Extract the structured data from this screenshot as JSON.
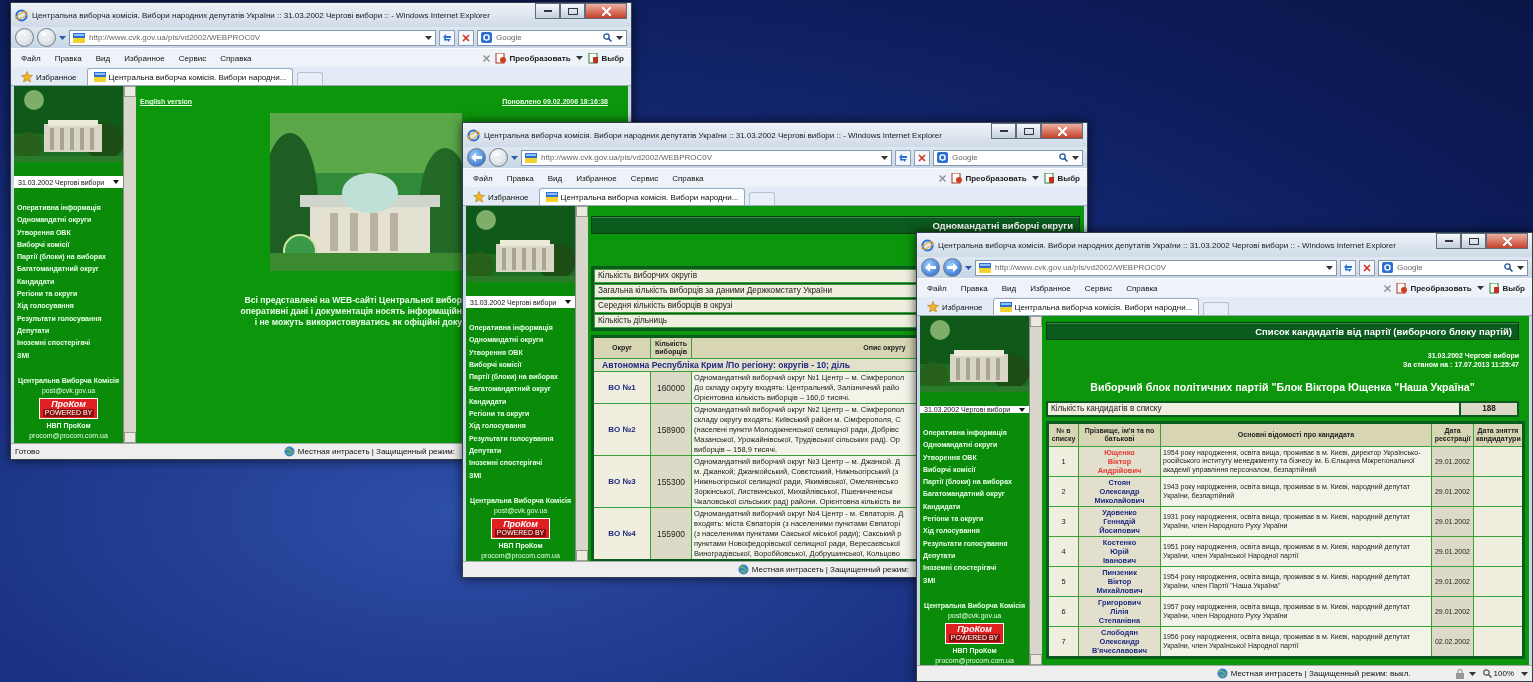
{
  "windows": [
    {
      "title": "Центральна виборча комісія. Вибори народних депутатів України :: 31.03.2002 Чергові вибори :: - Windows Internet Explorer",
      "back_enabled": false,
      "forward_enabled": false,
      "url": "http://www.cvk.gov.ua/pls/vd2002/WEBPROC0V",
      "search_placeholder": "Google",
      "menu": [
        "Файл",
        "Правка",
        "Вид",
        "Избранное",
        "Сервис",
        "Справка"
      ],
      "convert_label": "Преобразовать",
      "toolbar_cut": "Выбр",
      "favorites": "Избранное",
      "tab_title": "Центральна виборча комісія. Вибори народни...",
      "status_left": "Готово",
      "status_zone": "Местная интрасеть | Защищенный режим:",
      "sidebar": {
        "election": "31.03.2002 Чергові вибори",
        "nav": [
          "Оперативна інформація",
          "Одномандатні округи",
          "Утворення ОВК",
          "Виборчі комісії",
          "Партії (блоки) на виборах",
          "Багатомандатний округ",
          "Кандидати",
          "Регіони та округи",
          "Хід голосування",
          "Результати голосування",
          "Депутати",
          "Іноземні спостерігачі",
          "ЗМІ"
        ],
        "org": "Центральна Виборча Комісія",
        "org_email": "post@cvk.gov.ua",
        "logo_word": "ПроКом",
        "logo_tag": "POWERED BY",
        "company": "НВП ПроКом",
        "company_email": "procom@procom.com.ua"
      },
      "page": {
        "kind": "home",
        "english_link": "English version",
        "updated": "Поновлено 09.02.2006 18:16:38",
        "notice_lines": [
          "Всі представлені на WEB-сайті Центральної вибор",
          "оперативні дані і документація носять інформаційн",
          "і не можуть використовуватись як офіційні доку"
        ]
      }
    },
    {
      "title": "Центральна виборча комісія. Вибори народних депутатів України :: 31.03.2002 Чергові вибори :: - Windows Internet Explorer",
      "back_enabled": true,
      "forward_enabled": false,
      "url": "http://www.cvk.gov.ua/pls/vd2002/WEBPROC0V",
      "search_placeholder": "Google",
      "menu": [
        "Файл",
        "Правка",
        "Вид",
        "Избранное",
        "Сервис",
        "Справка"
      ],
      "convert_label": "Преобразовать",
      "toolbar_cut": "Выбр",
      "favorites": "Избранное",
      "tab_title": "Центральна виборча комісія. Вибори народни...",
      "status_zone": "Местная интрасеть | Защищенный режим:",
      "sidebar": {
        "election": "31.03.2002 Чергові вибори",
        "nav": [
          "Оперативна інформація",
          "Одномандатні округи",
          "Утворення ОВК",
          "Виборчі комісії",
          "Партії (блоки) на виборах",
          "Багатомандатний округ",
          "Кандидати",
          "Регіони та округи",
          "Хід голосування",
          "Результати голосування",
          "Депутати",
          "Іноземні спостерігачі",
          "ЗМІ"
        ],
        "org": "Центральна Виборча Комісія",
        "org_email": "post@cvk.gov.ua",
        "logo_word": "ПроКом",
        "logo_tag": "POWERED BY",
        "company": "НВП ПроКом",
        "company_email": "procom@procom.com.ua"
      },
      "page": {
        "kind": "districts",
        "heading": "Одномандатні виборчі округи",
        "summary": [
          "Кількість виборчих округів",
          "Загальна кількість виборців за даними Держкомстату України",
          "Середня кількість виборців в окрузі",
          "Кількість дільниць"
        ],
        "columns": [
          "Округ",
          "Кількість виборців",
          "Опис округу"
        ],
        "region": "Автономна Республіка Крим /По регіону: округів - 10; діль",
        "rows": [
          {
            "district": "ВО №1",
            "voters": "160000",
            "lines": [
              "Одномандатний виборчий округ №1 Центр – м. Сімферопол",
              "До складу округу входять: Центральний, Залізничний райо",
              "Орієнтовна кількість виборців – 160,0 тисячі."
            ]
          },
          {
            "district": "ВО №2",
            "voters": "158900",
            "lines": [
              "Одномандатний виборчий округ №2 Центр – м. Сімферопол",
              "складу округу входять: Київський район м. Сімферополя, С",
              "(населені пункти Молодіжненської селищної ради, Добрівс",
              "Мазанської, Урожайнівської, Трудівської сільських рад). Ор",
              "виборців – 158,9 тисячі."
            ]
          },
          {
            "district": "ВО №3",
            "voters": "155300",
            "lines": [
              "Одномандатний виборчий округ №3 Центр – м. Джанкой. Д",
              "м. Джанкой; Джанкойський, Совєтський, Нижньогірський (з",
              "Нижньогірської селищної ради, Якимівської, Омелянівсько",
              "Зоркінської, Листвинської, Михайлівської, Пшеничненськ",
              "Чкаловської сільських рад) райони. Орієнтовна кількість ви"
            ]
          },
          {
            "district": "ВО №4",
            "voters": "155900",
            "lines": [
              "Одномандатний виборчий округ №4 Центр - м. Євпаторія. Д",
              "входять: міста Євпаторія (з населеними пунктами Євпаторі",
              "(з населеними пунктами Сакської міської ради); Сакський р",
              "пунктами Новофедорівської селищної ради, Вересаєвської",
              "Виноградівської, Воробйовської, Добрушинської, Кольцово"
            ]
          }
        ]
      }
    },
    {
      "title": "Центральна виборча комісія. Вибори народних депутатів України :: 31.03.2002 Чергові вибори :: - Windows Internet Explorer",
      "back_enabled": true,
      "forward_enabled": true,
      "url": "http://www.cvk.gov.ua/pls/vd2002/WEBPROC0V",
      "search_placeholder": "Google",
      "menu": [
        "Файл",
        "Правка",
        "Вид",
        "Избранное",
        "Сервис",
        "Справка"
      ],
      "convert_label": "Преобразовать",
      "toolbar_cut": "Выбр",
      "favorites": "Избранное",
      "tab_title": "Центральна виборча комісія. Вибори народни...",
      "status_zone": "Местная интрасеть | Защищенный режим: выкл.",
      "zoom": "100%",
      "sidebar": {
        "election": "31.03.2002 Чергові вибори",
        "nav": [
          "Оперативна інформація",
          "Одномандатні округи",
          "Утворення ОВК",
          "Виборчі комісії",
          "Партії (блоки) на виборах",
          "Багатомандатний округ",
          "Кандидати",
          "Регіони та округи",
          "Хід голосування",
          "Результати голосування",
          "Депутати",
          "Іноземні спостерігачі",
          "ЗМІ"
        ],
        "org": "Центральна Виборча Комісія",
        "org_email": "post@cvk.gov.ua",
        "logo_word": "ПроКом",
        "logo_tag": "POWERED BY",
        "company": "НВП ПроКом",
        "company_email": "procom@procom.com.ua"
      },
      "page": {
        "kind": "candidates",
        "heading": "Список кандидатів від партії (виборчого блоку партій)",
        "election": "31.03.2002 Чергові вибори",
        "as_of": "За станом на : 17.07.2013 11:25:47",
        "party": "Виборчий блок політичних партій \"Блок Віктора Ющенка \"Наша Україна\"",
        "count_label": "Кількість кандидатів в списку",
        "count": "188",
        "columns": [
          "№ в списку",
          "Прізвище, ім'я та по батькові",
          "Основні відомості про кандидата",
          "Дата реєстрації",
          "Дата зняття кандидатури"
        ],
        "rows": [
          {
            "number": "1",
            "name": "Ющенко Віктор Андрійович",
            "color": "#e53935",
            "info": "1954 року народження, освіта вища, проживає в м. Києві, директор Українсько-російського інституту менеджменту та бізнесу ім. Б.Єльцина Міжрегіональної академії управління персоналом, безпартійний",
            "registered": "29.01.2002"
          },
          {
            "number": "2",
            "name": "Стоян Олександр Миколайович",
            "color": "#1f2a80",
            "info": "1943 року народження, освіта вища, проживає в м. Києві, народний депутат України, безпартійний",
            "registered": "29.01.2002"
          },
          {
            "number": "3",
            "name": "Удовенко Геннадій Йосипович",
            "color": "#1f2a80",
            "info": "1931 року народження, освіта вища, проживає в м. Києві, народний депутат України, член Народного Руху України",
            "registered": "29.01.2002"
          },
          {
            "number": "4",
            "name": "Костенко Юрій Іванович",
            "color": "#1f2a80",
            "info": "1951 року народження, освіта вища, проживає в м. Києві, народний депутат України, член Української Народної партії",
            "registered": "29.01.2002"
          },
          {
            "number": "5",
            "name": "Пинзеник Віктор Михайлович",
            "color": "#1f2a80",
            "info": "1954 року народження, освіта вища, проживає в м. Києві, народний депутат України, член Партії \"Наша Україна\"",
            "registered": "29.01.2002"
          },
          {
            "number": "6",
            "name": "Григорович Лілія Степанівна",
            "color": "#1f2a80",
            "info": "1957 року народження, освіта вища, проживає в м. Києві, народний депутат України, член Народного Руху України",
            "registered": "29.01.2002"
          },
          {
            "number": "7",
            "name": "Слободян Олександр В'ячеславович",
            "color": "#1f2a80",
            "info": "1956 року народження, освіта вища, проживає в м. Києві, народний депутат України, член Української Народної партії",
            "registered": "02.02.2002"
          }
        ]
      }
    }
  ]
}
